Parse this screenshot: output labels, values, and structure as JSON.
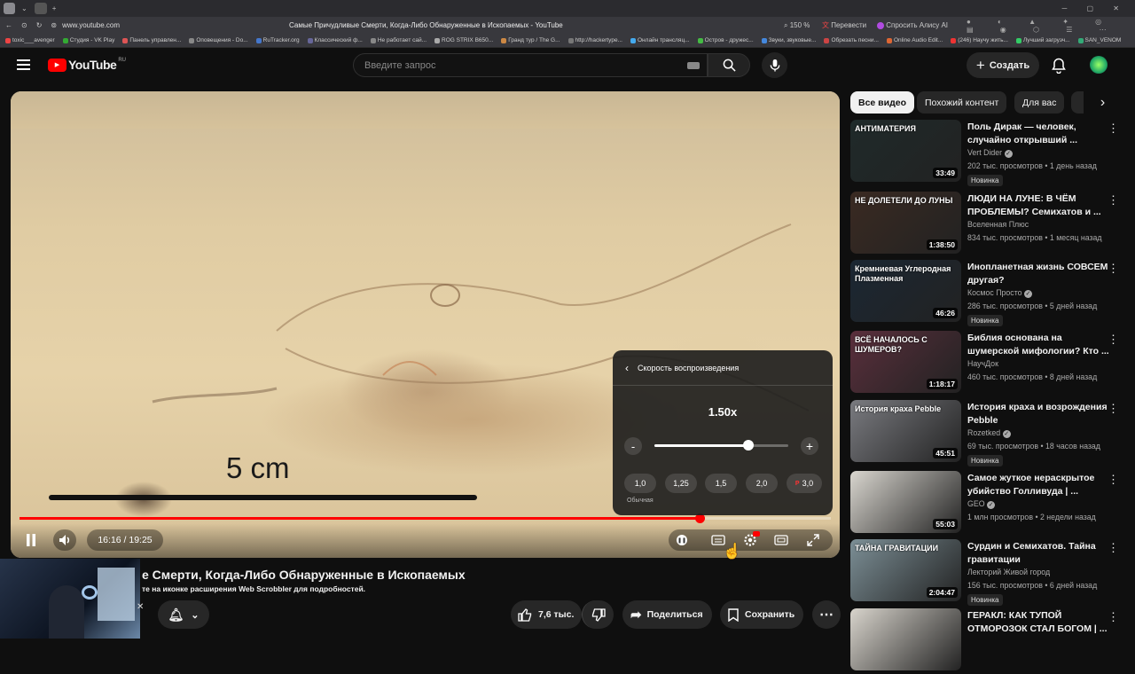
{
  "browser": {
    "url": "www.youtube.com",
    "title": "Самые Причудливые Смерти, Когда-Либо Обнаруженные в Ископаемых - YouTube",
    "zoom": "150 %",
    "translate": "Перевести",
    "ask_alice": "Спросить Алису AI",
    "bookmarks": [
      "toxic___avenger",
      "Студия - VK Play",
      "Панель управлен...",
      "Оповещения - Do...",
      "RuTracker.org",
      "Классический ф...",
      "Не работает сай...",
      "ROG STRIX B650...",
      "Гранд тур / The G...",
      "http://hackertype...",
      "Онлайн трансляц...",
      "Остров - дружес...",
      "Звуки, звуковые...",
      "Обрезать песни...",
      "Online Audio Edit...",
      "(246) Научу жить...",
      "Лучший загрузч...",
      "SAN_VENOM"
    ]
  },
  "header": {
    "logo_text": "YouTube",
    "region": "RU",
    "search_placeholder": "Введите запрос",
    "create_label": "Создать"
  },
  "player": {
    "scale_label": "5 cm",
    "time": "16:16 / 19:25",
    "progress_fraction": 0.838,
    "speed_menu": {
      "title": "Скорость воспроизведения",
      "current": "1.50x",
      "slider_fraction": 0.7,
      "minus": "-",
      "plus": "+",
      "presets": [
        "1,0",
        "1,25",
        "1,5",
        "2,0",
        "3,0"
      ],
      "normal_label": "Обычная",
      "premium_mark": "P"
    }
  },
  "video": {
    "title": "е Смерти, Когда-Либо Обнаруженные в Ископаемых",
    "scrobbler_note": "те на иконке расширения Web Scrobbler для подробностей.",
    "close": "✕",
    "likes": "7,6 тыс.",
    "share_label": "Поделиться",
    "save_label": "Сохранить"
  },
  "sidebar": {
    "chips": [
      "Все видео",
      "Похожий контент",
      "Для вас"
    ],
    "items": [
      {
        "title": "Поль Дирак — человек, случайно открывший ...",
        "channel": "Vert Dider",
        "verified": true,
        "meta": "202 тыс. просмотров • 1 день назад",
        "badge": "Новинка",
        "duration": "33:49",
        "thumb_text": "АНТИМАТЕРИЯ",
        "thumb_color": "#1f2a2a"
      },
      {
        "title": "ЛЮДИ НА ЛУНЕ: В ЧЁМ ПРОБЛЕМЫ? Семихатов и ...",
        "channel": "Вселенная Плюс",
        "verified": false,
        "meta": "834 тыс. просмотров • 1 месяц назад",
        "badge": "",
        "duration": "1:38:50",
        "thumb_text": "НЕ ДОЛЕТЕЛИ ДО ЛУНЫ",
        "thumb_color": "#3a2a22"
      },
      {
        "title": "Инопланетная жизнь СОВСЕМ другая?",
        "channel": "Космос Просто",
        "verified": true,
        "meta": "286 тыс. просмотров • 5 дней назад",
        "badge": "Новинка",
        "duration": "46:26",
        "thumb_text": "Кремниевая  Углеродная  Плазменная",
        "thumb_color": "#1b2733"
      },
      {
        "title": "Библия основана на шумерской мифологии? Кто ...",
        "channel": "НаучДок",
        "verified": false,
        "meta": "460 тыс. просмотров • 8 дней назад",
        "badge": "",
        "duration": "1:18:17",
        "thumb_text": "ВСЁ НАЧАЛОСЬ С ШУМЕРОВ?",
        "thumb_color": "#5a2f3c"
      },
      {
        "title": "История краха и возрождения Pebble",
        "channel": "Rozetked",
        "verified": true,
        "meta": "69 тыс. просмотров • 18 часов назад",
        "badge": "Новинка",
        "duration": "45:51",
        "thumb_text": "История краха Pebble",
        "thumb_color": "#7a7b80"
      },
      {
        "title": "Самое жуткое нераскрытое убийство Голливуда | ...",
        "channel": "GEO",
        "verified": true,
        "meta": "1 млн просмотров • 2 недели назад",
        "badge": "",
        "duration": "55:03",
        "thumb_text": "",
        "thumb_color": "#d9d6cf"
      },
      {
        "title": "Сурдин и Семихатов. Тайна гравитации",
        "channel": "Лекторий Живой город",
        "verified": false,
        "meta": "156 тыс. просмотров • 6 дней назад",
        "badge": "Новинка",
        "duration": "2:04:47",
        "thumb_text": "ТАЙНА ГРАВИТАЦИИ",
        "thumb_color": "#7c8f96"
      },
      {
        "title": "ГЕРАКЛ: КАК ТУПОЙ ОТМОРОЗОК СТАЛ БОГОМ | ...",
        "channel": "",
        "verified": false,
        "meta": "",
        "badge": "",
        "duration": "",
        "thumb_text": "",
        "thumb_color": "#d8d4cc"
      }
    ]
  },
  "colors": {
    "accent": "#ff0000",
    "bg": "#0f0f0f",
    "chip_active": "#f1f1f1"
  }
}
